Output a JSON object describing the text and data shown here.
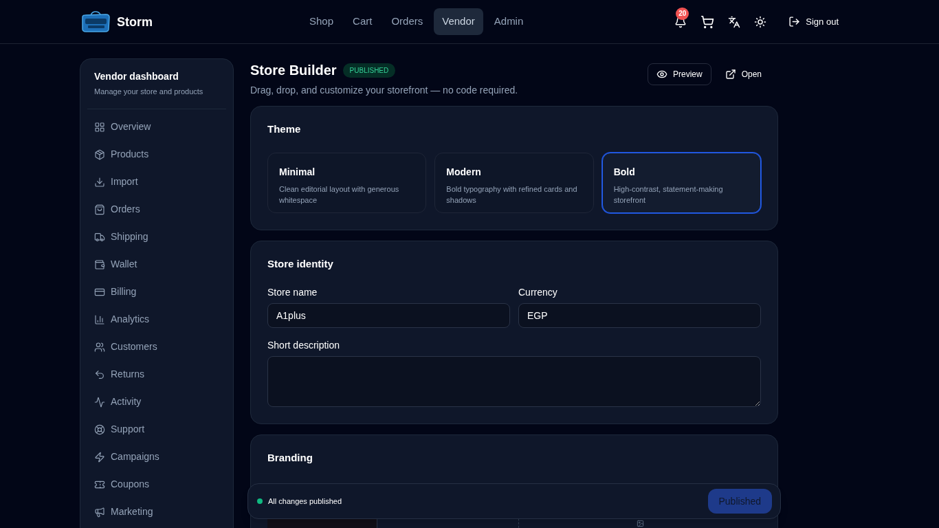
{
  "header": {
    "brand": "Storm",
    "nav": [
      {
        "label": "Shop",
        "selected": false
      },
      {
        "label": "Cart",
        "selected": false
      },
      {
        "label": "Orders",
        "selected": false
      },
      {
        "label": "Vendor",
        "selected": true
      },
      {
        "label": "Admin",
        "selected": false
      }
    ],
    "notification_count": "20",
    "sign_out": "Sign out"
  },
  "sidebar": {
    "title": "Vendor dashboard",
    "subtitle": "Manage your store and products",
    "items": [
      "Overview",
      "Products",
      "Import",
      "Orders",
      "Shipping",
      "Wallet",
      "Billing",
      "Analytics",
      "Customers",
      "Returns",
      "Activity",
      "Support",
      "Campaigns",
      "Coupons",
      "Marketing"
    ]
  },
  "page": {
    "title": "Store Builder",
    "status": "PUBLISHED",
    "subtitle": "Drag, drop, and customize your storefront — no code required.",
    "actions": [
      "Preview",
      "Open"
    ]
  },
  "theme": {
    "title": "Theme",
    "options": [
      {
        "name": "Minimal",
        "description": "Clean editorial layout with generous whitespace",
        "selected": false
      },
      {
        "name": "Modern",
        "description": "Bold typography with refined cards and shadows",
        "selected": false
      },
      {
        "name": "Bold",
        "description": "High-contrast, statement-making storefront",
        "selected": true
      }
    ]
  },
  "identity": {
    "title": "Store identity",
    "store_name": {
      "label": "Store name",
      "value": "A1plus"
    },
    "currency": {
      "label": "Currency",
      "value": "EGP"
    },
    "description": {
      "label": "Short description"
    }
  },
  "branding": {
    "title": "Branding"
  },
  "toast": {
    "message": "All changes published",
    "button": "Published"
  }
}
